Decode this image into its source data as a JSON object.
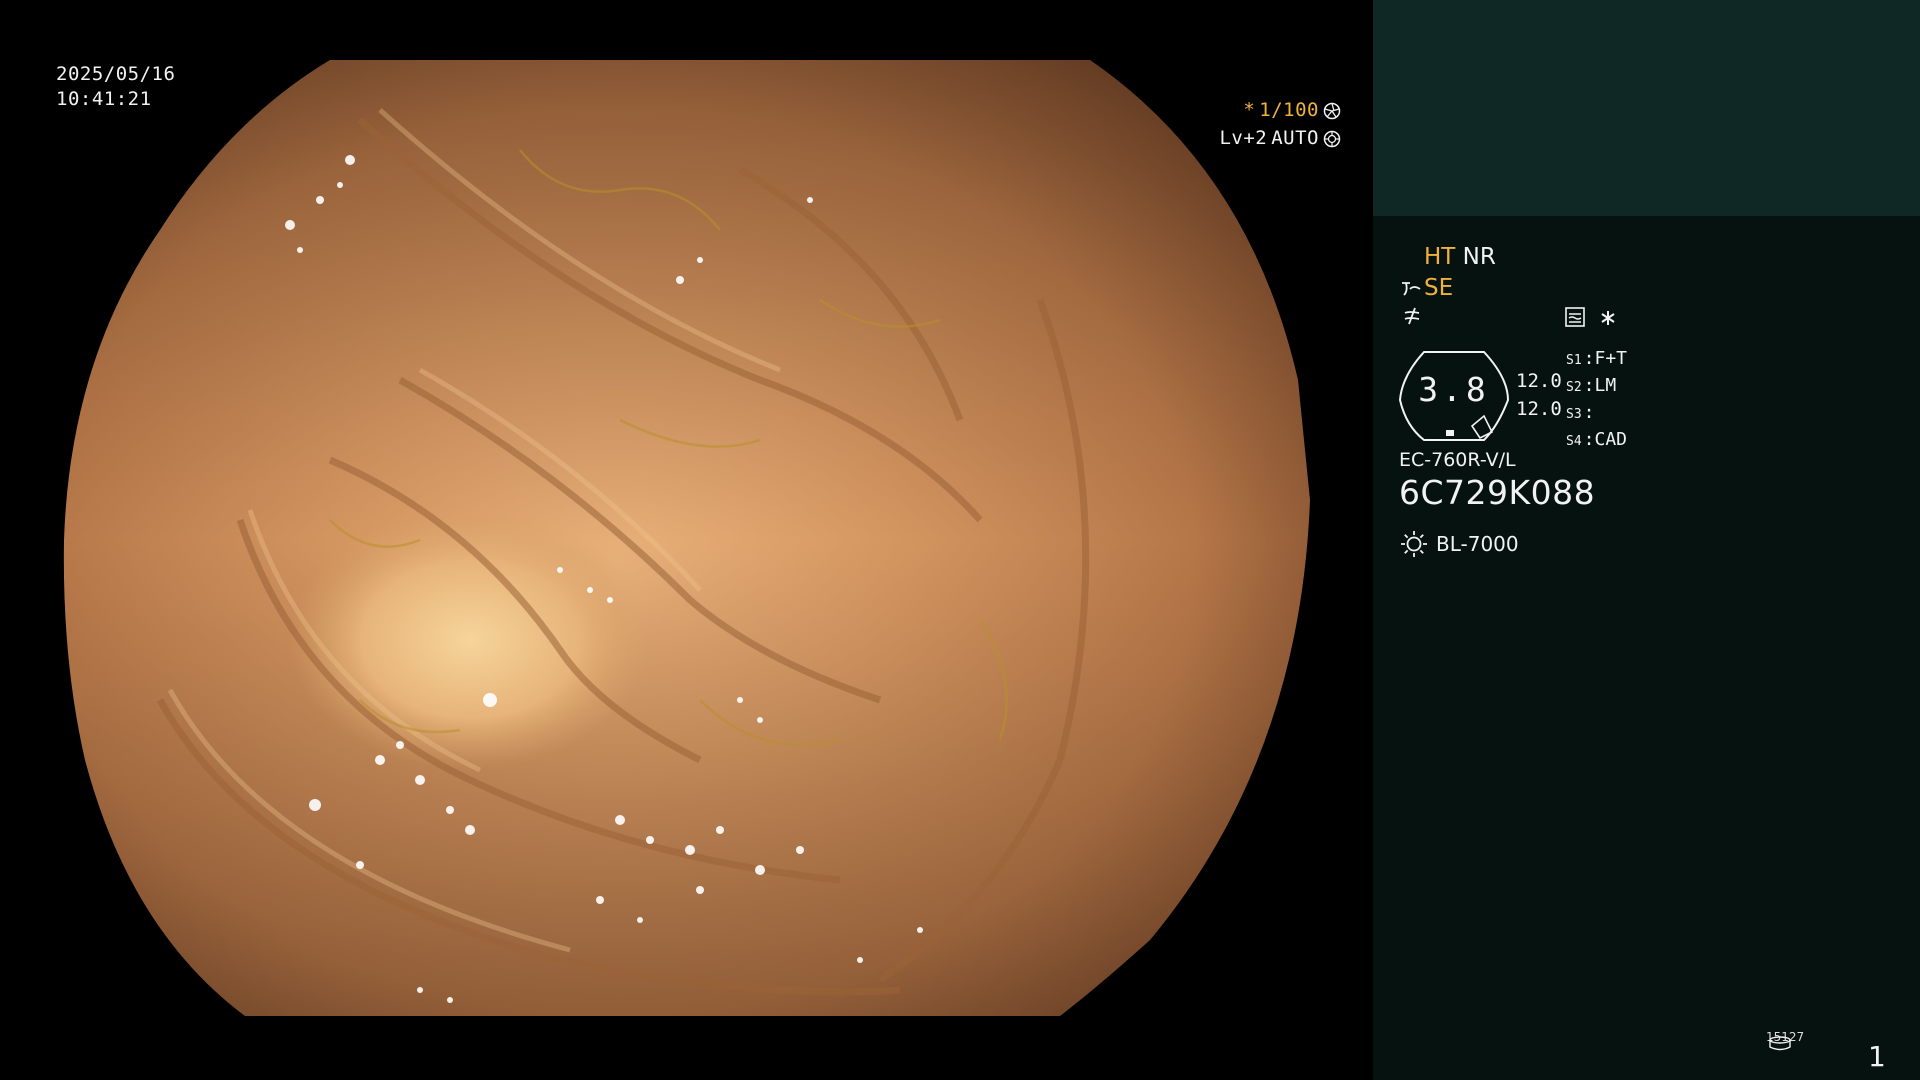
{
  "image_view": {
    "date": "2025/05/16",
    "time": "10:41:21",
    "shutter_prefix": "*",
    "shutter": "1/100",
    "level": "Lv+2",
    "exposure": "AUTO",
    "colors": {
      "accent_yellow": "#f0b23c",
      "text": "#f2f2f2"
    }
  },
  "info_panel": {
    "modes": {
      "ht": "HT",
      "nr": "NR",
      "se": "SE"
    },
    "badge_value": "3.8",
    "param_1": "12.0",
    "param_2": "12.0",
    "switches": [
      {
        "key": "S1",
        "value": "F+T"
      },
      {
        "key": "S2",
        "value": "LM"
      },
      {
        "key": "S3",
        "value": ""
      },
      {
        "key": "S4",
        "value": "CAD"
      }
    ],
    "scope_model": "EC-760R-V/L",
    "scope_serial": "6C729K088",
    "light_source": "BL-7000",
    "record_label": "15127",
    "page_number": "1",
    "icons": {
      "shutter_mode": "aperture-icon",
      "exposure_mode": "iris-icon",
      "enhancement": "enhancement-curve-icon",
      "sharpness": "sharpness-icon",
      "display_mode": "display-mode-icon",
      "star": "asterisk-icon",
      "light": "light-source-icon",
      "record": "record-media-icon"
    },
    "colors": {
      "panel_bg": "#061210",
      "header_bg": "#0f2826"
    }
  }
}
